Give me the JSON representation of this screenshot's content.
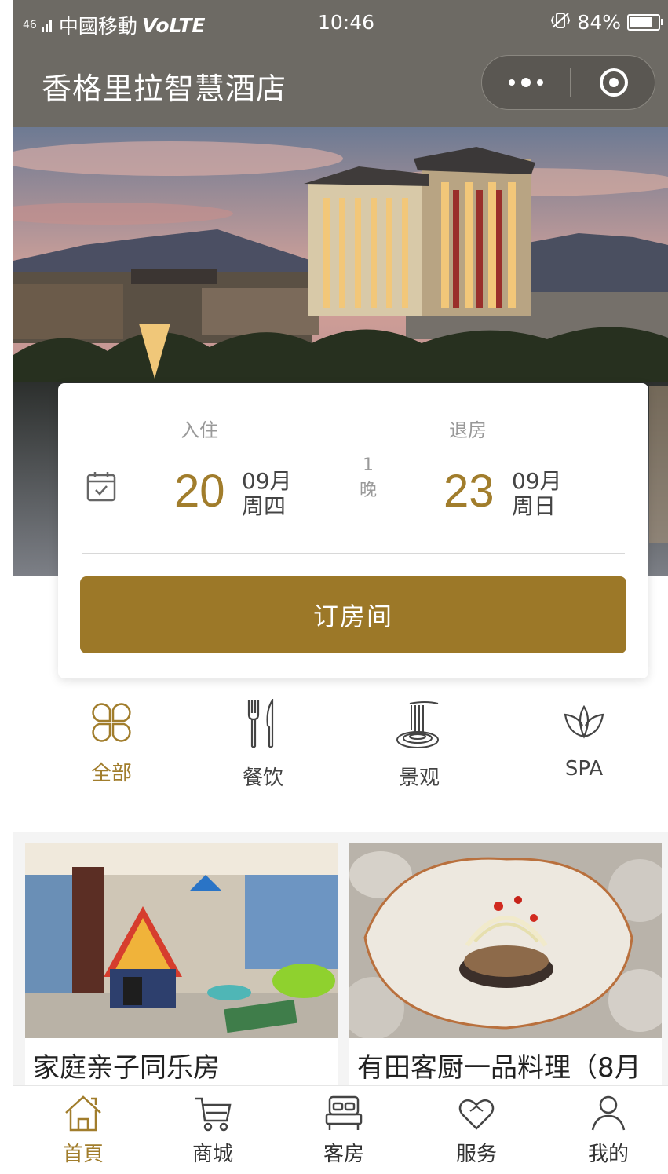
{
  "status_bar": {
    "signal": "46",
    "carrier": "中國移動",
    "volte": "VoLTE",
    "time": "10:46",
    "battery": "84%",
    "battery_level": 0.84
  },
  "nav": {
    "title": "香格里拉智慧酒店"
  },
  "booking": {
    "checkin_label": "入住",
    "checkout_label": "退房",
    "checkin_day": "20",
    "checkin_month": "09月",
    "checkin_weekday": "周四",
    "nights_count": "1",
    "nights_unit": "晚",
    "checkout_day": "23",
    "checkout_month": "09月",
    "checkout_weekday": "周日",
    "book_button": "订房间"
  },
  "categories": [
    {
      "label": "全部",
      "icon": "clover-icon",
      "active": true
    },
    {
      "label": "餐饮",
      "icon": "cutlery-icon",
      "active": false
    },
    {
      "label": "景观",
      "icon": "waterfall-icon",
      "active": false
    },
    {
      "label": "SPA",
      "icon": "lotus-icon",
      "active": false
    }
  ],
  "listings": [
    {
      "title": "家庭亲子同乐房"
    },
    {
      "title": "有田客厨一品料理（8月"
    }
  ],
  "tabs": [
    {
      "label": "首頁",
      "icon": "home-icon",
      "active": true
    },
    {
      "label": "商城",
      "icon": "cart-icon",
      "active": false
    },
    {
      "label": "客房",
      "icon": "bed-icon",
      "active": false
    },
    {
      "label": "服务",
      "icon": "heart-icon",
      "active": false
    },
    {
      "label": "我的",
      "icon": "user-icon",
      "active": false
    }
  ],
  "colors": {
    "accent": "#9c7828",
    "nav_bg": "#6d6a64"
  }
}
